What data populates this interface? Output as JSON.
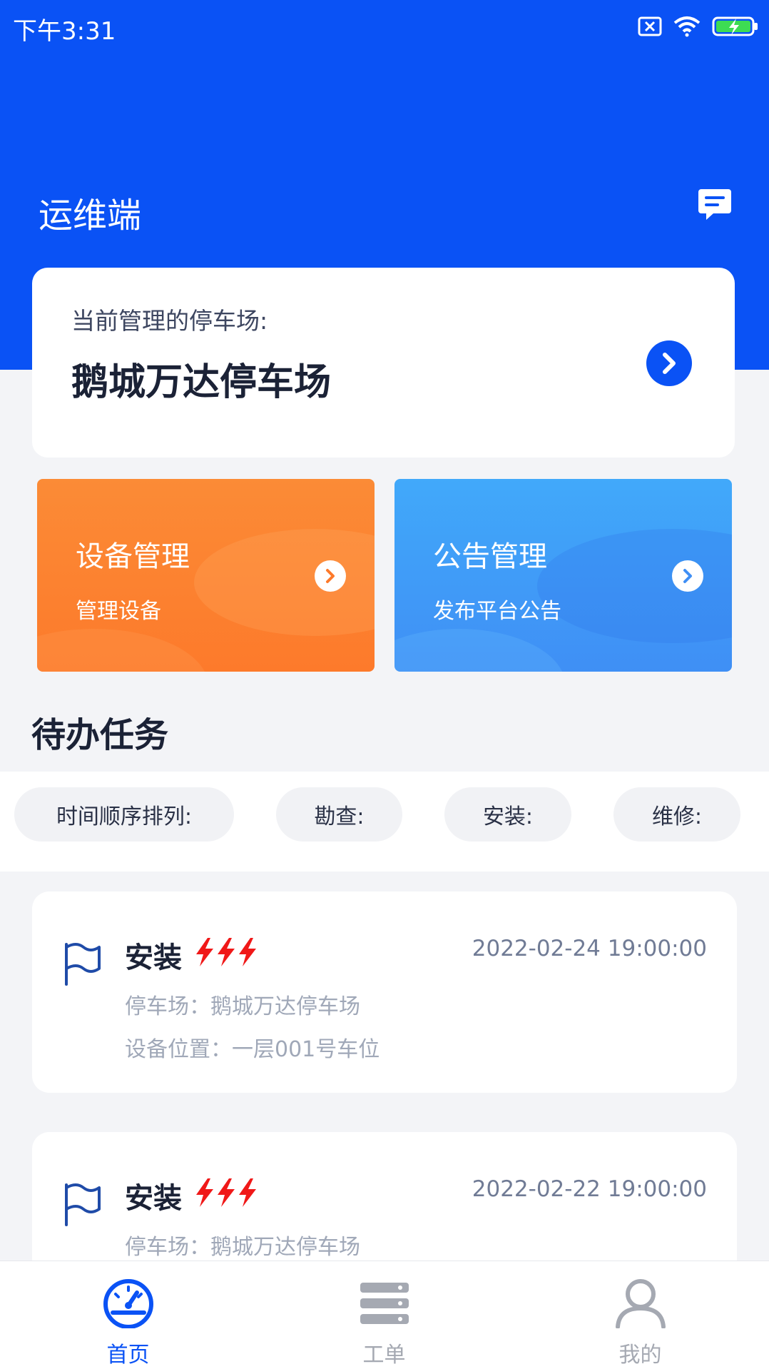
{
  "status_bar": {
    "time": "下午3:31"
  },
  "header": {
    "title": "运维端"
  },
  "lot_card": {
    "label": "当前管理的停车场:",
    "name": "鹅城万达停车场"
  },
  "tiles": [
    {
      "title": "设备管理",
      "subtitle": "管理设备"
    },
    {
      "title": "公告管理",
      "subtitle": "发布平台公告"
    }
  ],
  "section_title": "待办任务",
  "filters": [
    "时间顺序排列:",
    "勘查:",
    "安装:",
    "维修:"
  ],
  "tasks": [
    {
      "type": "安装",
      "time": "2022-02-24 19:00:00",
      "lot": "停车场：鹅城万达停车场",
      "location": "设备位置：一层001号车位"
    },
    {
      "type": "安装",
      "time": "2022-02-22 19:00:00",
      "lot": "停车场：鹅城万达停车场"
    }
  ],
  "tabbar": {
    "items": [
      {
        "label": "首页",
        "icon": "dashboard-icon",
        "active": true
      },
      {
        "label": "工单",
        "icon": "list-icon",
        "active": false
      },
      {
        "label": "我的",
        "icon": "user-icon",
        "active": false
      }
    ]
  },
  "colors": {
    "primary": "#0a52f5",
    "orange_tile": "#fd7a2b",
    "blue_tile": "#3f8ff5",
    "urgency": "#f01818",
    "tab_active": "#0a52f5",
    "tab_inactive": "#a5a9b2"
  }
}
